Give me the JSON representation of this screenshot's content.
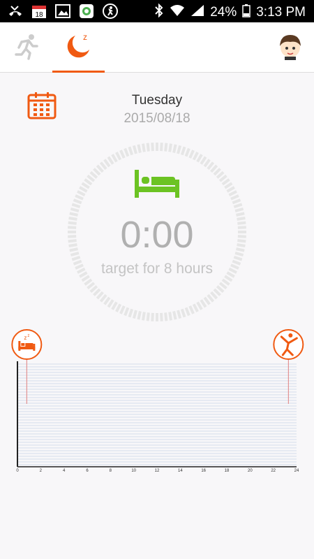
{
  "status_bar": {
    "calendar_day": "18",
    "battery": "24%",
    "time": "3:13 PM"
  },
  "tabs": [
    {
      "name": "run",
      "icon": "running-man-icon",
      "selected": false
    },
    {
      "name": "sleep",
      "icon": "moon-z-icon",
      "selected": true
    }
  ],
  "header": {
    "day": "Tuesday",
    "date": "2015/08/18"
  },
  "sleep_summary": {
    "duration": "0:00",
    "target": "target for 8 hours"
  },
  "colors": {
    "accent": "#f05a12",
    "bed_green": "#6cc323"
  },
  "chart_data": {
    "type": "line",
    "x": [
      0,
      2,
      4,
      6,
      8,
      10,
      12,
      14,
      16,
      18,
      20,
      22,
      24
    ],
    "xlim": [
      0,
      24
    ],
    "series": [],
    "markers": [
      {
        "icon": "sleep-start-icon",
        "x": 0.8
      },
      {
        "icon": "wake-up-icon",
        "x": 23.3
      }
    ]
  }
}
